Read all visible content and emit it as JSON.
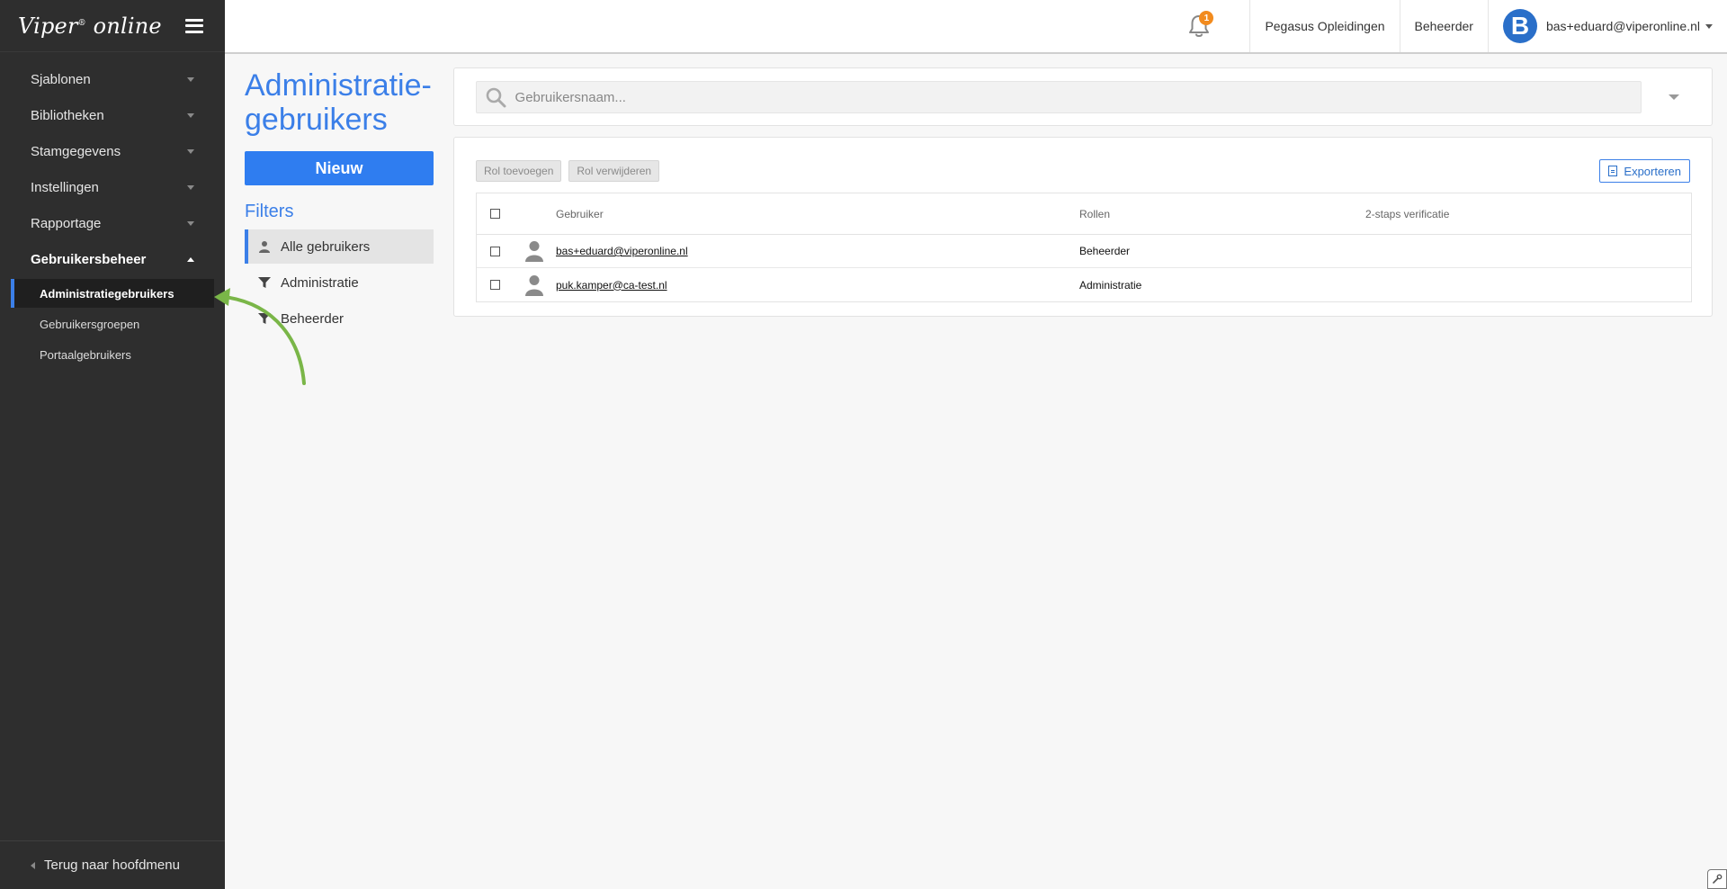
{
  "sidebar": {
    "logo": "Viper",
    "logo_mark": "®",
    "logo_suffix": "online",
    "items": [
      {
        "label": "Sjablonen"
      },
      {
        "label": "Bibliotheken"
      },
      {
        "label": "Stamgegevens"
      },
      {
        "label": "Instellingen"
      },
      {
        "label": "Rapportage"
      },
      {
        "label": "Gebruikersbeheer"
      }
    ],
    "subitems": [
      {
        "label": "Administratiegebruikers"
      },
      {
        "label": "Gebruikersgroepen"
      },
      {
        "label": "Portaalgebruikers"
      }
    ],
    "footer": "Terug naar hoofdmenu"
  },
  "topbar": {
    "notification_count": "1",
    "organization": "Pegasus Opleidingen",
    "role": "Beheerder",
    "avatar_letter": "B",
    "user_email": "bas+eduard@viperonline.nl"
  },
  "page": {
    "title": "Administratie-gebruikers",
    "new_button": "Nieuw",
    "filters_title": "Filters",
    "filters": [
      {
        "label": "Alle gebruikers"
      },
      {
        "label": "Administratie"
      },
      {
        "label": "Beheerder"
      }
    ]
  },
  "search": {
    "placeholder": "Gebruikersnaam..."
  },
  "toolbar": {
    "add_role": "Rol toevoegen",
    "remove_role": "Rol verwijderen",
    "export": "Exporteren"
  },
  "table": {
    "columns": [
      "Gebruiker",
      "Rollen",
      "2-staps verificatie"
    ],
    "rows": [
      {
        "user": "bas+eduard@viperonline.nl",
        "roles": "Beheerder",
        "two_factor": ""
      },
      {
        "user": "puk.kamper@ca-test.nl",
        "roles": "Administratie",
        "two_factor": ""
      }
    ]
  },
  "colors": {
    "accent": "#3b7fe8",
    "sidebar_bg": "#2e2e2e",
    "badge": "#f28b1e",
    "annotation_arrow": "#7ab648"
  }
}
